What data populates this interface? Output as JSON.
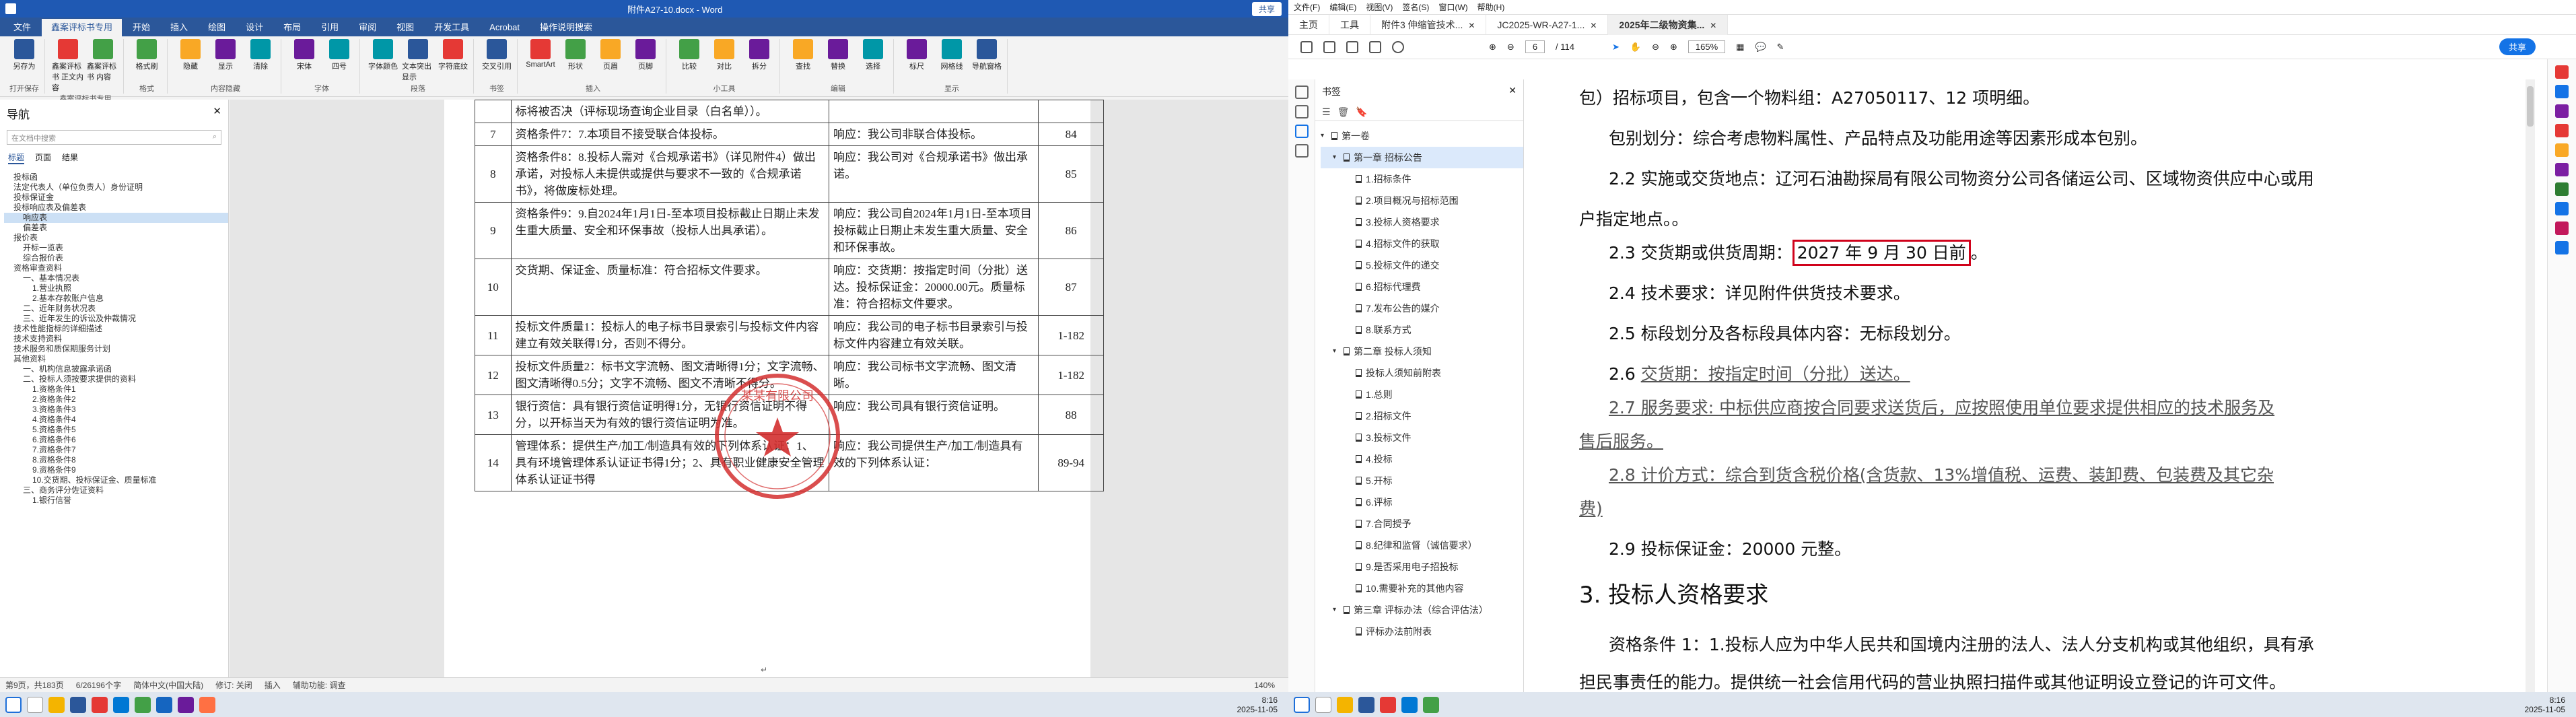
{
  "word": {
    "title": "附件A27-10.docx - Word",
    "user_button": "共享",
    "tabs": [
      "文件",
      "鑫案评标书专用",
      "开始",
      "插入",
      "绘图",
      "设计",
      "布局",
      "引用",
      "审阅",
      "视图",
      "开发工具",
      "Acrobat",
      "操作说明搜索"
    ],
    "active_tab": "鑫案评标书专用",
    "ribbon_groups": [
      {
        "label": "打开保存",
        "buttons": [
          "另存为"
        ]
      },
      {
        "label": "鑫案评标书专用",
        "buttons": [
          "鑫案评标书 正文内容",
          "鑫案评标书 内容"
        ]
      },
      {
        "label": "格式",
        "buttons": [
          "格式刷"
        ]
      },
      {
        "label": "内容隐藏",
        "buttons": [
          "隐藏",
          "显示",
          "清除"
        ]
      },
      {
        "label": "字体",
        "buttons": [
          "宋体",
          "四号"
        ]
      },
      {
        "label": "段落",
        "buttons": [
          "字体颜色",
          "文本突出显示",
          "字符底纹"
        ]
      },
      {
        "label": "书签",
        "buttons": [
          "交叉引用"
        ]
      },
      {
        "label": "插入",
        "buttons": [
          "SmartArt",
          "形状",
          "页眉",
          "页脚"
        ]
      },
      {
        "label": "小工具",
        "buttons": [
          "比较",
          "对比",
          "拆分"
        ]
      },
      {
        "label": "编辑",
        "buttons": [
          "查找",
          "替换",
          "选择"
        ]
      },
      {
        "label": "显示",
        "buttons": [
          "标尺",
          "网格线",
          "导航窗格"
        ]
      }
    ],
    "nav": {
      "title": "导航",
      "search_placeholder": "在文档中搜索",
      "tabs": [
        "标题",
        "页面",
        "结果"
      ],
      "items": [
        "投标函",
        "法定代表人（单位负责人）身份证明",
        "投标保证金",
        "投标响应表及偏差表",
        "响应表",
        "偏差表",
        "报价表",
        "开标一览表",
        "综合报价表",
        "资格审查资料",
        "一、基本情况表",
        "1.营业执照",
        "2.基本存款账户信息",
        "二、近年财务状况表",
        "三、近年发生的诉讼及仲裁情况",
        "技术性能指标的详细描述",
        "技术支持资料",
        "技术服务和质保期服务计划",
        "其他资料",
        "一、机构信息披露承诺函",
        "二、投标人须按要求提供的资料",
        "1.资格条件1",
        "2.资格条件2",
        "3.资格条件3",
        "4.资格条件4",
        "5.资格条件5",
        "6.资格条件6",
        "7.资格条件7",
        "8.资格条件8",
        "9.资格条件9",
        "10.交货期、投标保证金、质量标准",
        "三、商务评分佐证资料",
        "1.银行信誉"
      ],
      "selected": "响应表"
    },
    "table_rows": [
      {
        "no": "",
        "req": "标将被否决（评标现场查询企业目录（白名单））。",
        "resp": "",
        "page": ""
      },
      {
        "no": "7",
        "req": "资格条件7：7.本项目不接受联合体投标。",
        "resp": "响应：我公司非联合体投标。",
        "page": "84"
      },
      {
        "no": "8",
        "req": "资格条件8：8.投标人需对《合规承诺书》（详见附件4）做出承诺，对投标人未提供或提供与要求不一致的《合规承诺书》，将做废标处理。",
        "resp": "响应：我公司对《合规承诺书》做出承诺。",
        "page": "85"
      },
      {
        "no": "9",
        "req": "资格条件9：9.自2024年1月1日-至本项目投标截止日期止未发生重大质量、安全和环保事故（投标人出具承诺）。",
        "resp": "响应：我公司自2024年1月1日-至本项目投标截止日期止未发生重大质量、安全和环保事故。",
        "page": "86"
      },
      {
        "no": "10",
        "req": "交货期、保证金、质量标准：符合招标文件要求。",
        "resp": "响应：交货期：按指定时间（分批）送达。投标保证金：20000.00元。质量标准：符合招标文件要求。",
        "page": "87"
      },
      {
        "no": "11",
        "req": "投标文件质量1：投标人的电子标书目录索引与投标文件内容建立有效关联得1分，否则不得分。",
        "resp": "响应：我公司的电子标书目录索引与投标文件内容建立有效关联。",
        "page": "1-182"
      },
      {
        "no": "12",
        "req": "投标文件质量2：标书文字流畅、图文清晰得1分；文字流畅、图文清晰得0.5分；文字不流畅、图文不清晰不得分。",
        "resp": "响应：我公司标书文字流畅、图文清晰。",
        "page": "1-182"
      },
      {
        "no": "13",
        "req": "银行资信：具有银行资信证明得1分，无银行资信证明不得分，以开标当天为有效的银行资信证明为准。",
        "resp": "响应：我公司具有银行资信证明。",
        "page": "88"
      },
      {
        "no": "14",
        "req": "管理体系：提供生产/加工/制造具有效的下列体系认证：1、具有环境管理体系认证证书得1分；2、具有职业健康安全管理体系认证证书得",
        "resp": "响应：我公司提供生产/加工/制造具有效的下列体系认证：",
        "page": "89-94"
      }
    ],
    "seal_text": "某某有限公司",
    "status": {
      "page": "第9页，共183页",
      "words": "6/26196个字",
      "lang": "简体中文(中国大陆)",
      "mode": "修订: 关闭",
      "insert": "插入",
      "access": "辅助功能: 调查",
      "zoom": "140%"
    },
    "time": "8:16",
    "date": "2025-11-05"
  },
  "acrobat": {
    "menu": [
      "文件(F)",
      "编辑(E)",
      "视图(V)",
      "签名(S)",
      "窗口(W)",
      "帮助(H)"
    ],
    "tabs": [
      "主页",
      "工具",
      "附件3 伸缩管技术...",
      "JC2025-WR-A27-1...",
      "2025年二级物资集..."
    ],
    "active_tab": "2025年二级物资集...",
    "share_button": "共享",
    "page_current": "6",
    "page_total": "/ 114",
    "zoom": "165%",
    "bookmarks_title": "书签",
    "bookmarks": [
      {
        "label": "第一卷",
        "level": 0
      },
      {
        "label": "第一章 招标公告",
        "level": 1,
        "sel": true
      },
      {
        "label": "1.招标条件",
        "level": 2
      },
      {
        "label": "2.项目概况与招标范围",
        "level": 2
      },
      {
        "label": "3.投标人资格要求",
        "level": 2
      },
      {
        "label": "4.招标文件的获取",
        "level": 2
      },
      {
        "label": "5.投标文件的递交",
        "level": 2
      },
      {
        "label": "6.招标代理费",
        "level": 2
      },
      {
        "label": "7.发布公告的媒介",
        "level": 2
      },
      {
        "label": "8.联系方式",
        "level": 2
      },
      {
        "label": "第二章 投标人须知",
        "level": 1
      },
      {
        "label": "投标人须知前附表",
        "level": 2
      },
      {
        "label": "1.总则",
        "level": 2
      },
      {
        "label": "2.招标文件",
        "level": 2
      },
      {
        "label": "3.投标文件",
        "level": 2
      },
      {
        "label": "4.投标",
        "level": 2
      },
      {
        "label": "5.开标",
        "level": 2
      },
      {
        "label": "6.评标",
        "level": 2
      },
      {
        "label": "7.合同授予",
        "level": 2
      },
      {
        "label": "8.纪律和监督（诚信要求）",
        "level": 2
      },
      {
        "label": "9.是否采用电子招投标",
        "level": 2
      },
      {
        "label": "10.需要补充的其他内容",
        "level": 2
      },
      {
        "label": "第三章 评标办法（综合评估法）",
        "level": 1
      },
      {
        "label": "评标办法前附表",
        "level": 2
      }
    ],
    "content": {
      "l1": "包）招标项目，包含一个物料组：A27050117、12 项明细。",
      "l2": "包别划分：综合考虑物料属性、产品特点及功能用途等因素形成本包别。",
      "l3": "2.2 实施或交货地点：辽河石油勘探局有限公司物资分公司各储运公司、区域物资供应中心或用",
      "l4": "户指定地点。。",
      "l5a": "2.3 交货期或供货周期：",
      "l5b": "2027 年 9 月 30 日前",
      "l5c": "。",
      "l6": "2.4 技术要求：详见附件供货技术要求。",
      "l7": "2.5 标段划分及各标段具体内容：无标段划分。",
      "l8a": "2.6 ",
      "l8b": "交货期：按指定时间（分批）送达。",
      "l9": "2.7 服务要求: 中标供应商按合同要求送货后，应按照使用单位要求提供相应的技术服务及",
      "l10": "售后服务。",
      "l11": "2.8 计价方式：综合到货含税价格(含货款、13%增值税、运费、装卸费、包装费及其它杂",
      "l12": "费)",
      "l13": "2.9 投标保证金：20000 元整。",
      "h3": "3. 投标人资格要求",
      "l14": "资格条件 1：1.投标人应为中华人民共和国境内注册的法人、法人分支机构或其他组织，具有承",
      "l15": "担民事责任的能力。提供统一社会信用代码的营业执照扫描件或其他证明设立登记的许可文件。"
    },
    "highlight_color": "#d0021b",
    "time": "8:16",
    "date": "2025-11-05"
  }
}
